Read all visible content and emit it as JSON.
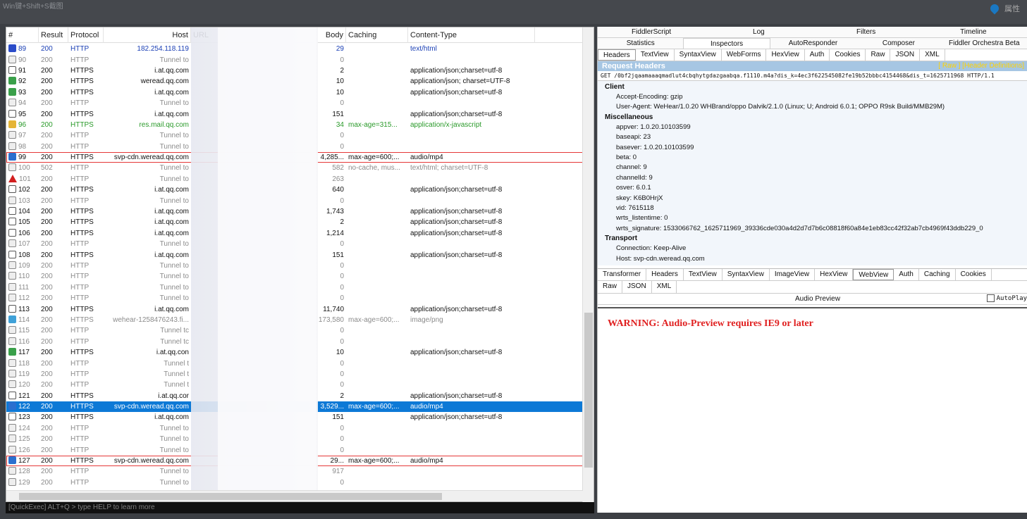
{
  "tip": "Win键+Shift+S截图",
  "top_right": {
    "label": "属性"
  },
  "columns": [
    "#",
    "Result",
    "Protocol",
    "Host",
    "URL",
    "Body",
    "Caching",
    "Content-Type"
  ],
  "sessions": [
    {
      "num": "89",
      "res": "200",
      "proto": "HTTP",
      "host": "182.254.118.119",
      "body": "29",
      "cache": "",
      "ctype": "text/html",
      "kind": "blue",
      "icon": "i-dbl"
    },
    {
      "num": "90",
      "res": "200",
      "proto": "HTTP",
      "host": "Tunnel to",
      "body": "0",
      "cache": "",
      "ctype": "",
      "kind": "tunnel",
      "icon": "i-lock"
    },
    {
      "num": "91",
      "res": "200",
      "proto": "HTTPS",
      "host": "i.at.qq.com",
      "body": "2",
      "cache": "",
      "ctype": "application/json;charset=utf-8",
      "kind": "https",
      "icon": "i-json"
    },
    {
      "num": "92",
      "res": "200",
      "proto": "HTTPS",
      "host": "weread.qq.com",
      "body": "10",
      "cache": "",
      "ctype": "application/json; charset=UTF-8",
      "kind": "https",
      "icon": "i-arrow"
    },
    {
      "num": "93",
      "res": "200",
      "proto": "HTTPS",
      "host": "i.at.qq.com",
      "body": "10",
      "cache": "",
      "ctype": "application/json;charset=utf-8",
      "kind": "https",
      "icon": "i-arrow"
    },
    {
      "num": "94",
      "res": "200",
      "proto": "HTTP",
      "host": "Tunnel to",
      "body": "0",
      "cache": "",
      "ctype": "",
      "kind": "tunnel",
      "icon": "i-lock"
    },
    {
      "num": "95",
      "res": "200",
      "proto": "HTTPS",
      "host": "i.at.qq.com",
      "body": "151",
      "cache": "",
      "ctype": "application/json;charset=utf-8",
      "kind": "https",
      "icon": "i-json"
    },
    {
      "num": "96",
      "res": "200",
      "proto": "HTTPS",
      "host": "res.mail.qq.com",
      "body": "34",
      "cache": "max-age=315...",
      "ctype": "application/x-javascript",
      "kind": "green",
      "icon": "i-js"
    },
    {
      "num": "97",
      "res": "200",
      "proto": "HTTP",
      "host": "Tunnel to",
      "body": "0",
      "cache": "",
      "ctype": "",
      "kind": "tunnel",
      "icon": "i-lock"
    },
    {
      "num": "98",
      "res": "200",
      "proto": "HTTP",
      "host": "Tunnel to",
      "body": "0",
      "cache": "",
      "ctype": "",
      "kind": "tunnel",
      "icon": "i-lock"
    },
    {
      "num": "99",
      "res": "200",
      "proto": "HTTPS",
      "host": "svp-cdn.weread.qq.com",
      "body": "4,285...",
      "cache": "max-age=600;...",
      "ctype": "audio/mp4",
      "kind": "https boxed",
      "icon": "i-audio"
    },
    {
      "num": "100",
      "res": "502",
      "proto": "HTTP",
      "host": "Tunnel to",
      "body": "582",
      "cache": "no-cache, mus...",
      "ctype": "text/html; charset=UTF-8",
      "kind": "tunnel",
      "icon": "i-lock"
    },
    {
      "num": "101",
      "res": "200",
      "proto": "HTTP",
      "host": "Tunnel to",
      "body": "263",
      "cache": "",
      "ctype": "",
      "kind": "tunnel",
      "icon": "i-warn"
    },
    {
      "num": "102",
      "res": "200",
      "proto": "HTTPS",
      "host": "i.at.qq.com",
      "body": "640",
      "cache": "",
      "ctype": "application/json;charset=utf-8",
      "kind": "https",
      "icon": "i-json"
    },
    {
      "num": "103",
      "res": "200",
      "proto": "HTTP",
      "host": "Tunnel to",
      "body": "0",
      "cache": "",
      "ctype": "",
      "kind": "tunnel",
      "icon": "i-lock"
    },
    {
      "num": "104",
      "res": "200",
      "proto": "HTTPS",
      "host": "i.at.qq.com",
      "body": "1,743",
      "cache": "",
      "ctype": "application/json;charset=utf-8",
      "kind": "https",
      "icon": "i-json"
    },
    {
      "num": "105",
      "res": "200",
      "proto": "HTTPS",
      "host": "i.at.qq.com",
      "body": "2",
      "cache": "",
      "ctype": "application/json;charset=utf-8",
      "kind": "https",
      "icon": "i-json"
    },
    {
      "num": "106",
      "res": "200",
      "proto": "HTTPS",
      "host": "i.at.qq.com",
      "body": "1,214",
      "cache": "",
      "ctype": "application/json;charset=utf-8",
      "kind": "https",
      "icon": "i-json"
    },
    {
      "num": "107",
      "res": "200",
      "proto": "HTTP",
      "host": "Tunnel to",
      "body": "0",
      "cache": "",
      "ctype": "",
      "kind": "tunnel",
      "icon": "i-lock"
    },
    {
      "num": "108",
      "res": "200",
      "proto": "HTTPS",
      "host": "i.at.qq.com",
      "body": "151",
      "cache": "",
      "ctype": "application/json;charset=utf-8",
      "kind": "https",
      "icon": "i-json"
    },
    {
      "num": "109",
      "res": "200",
      "proto": "HTTP",
      "host": "Tunnel to",
      "body": "0",
      "cache": "",
      "ctype": "",
      "kind": "tunnel",
      "icon": "i-lock"
    },
    {
      "num": "110",
      "res": "200",
      "proto": "HTTP",
      "host": "Tunnel to",
      "body": "0",
      "cache": "",
      "ctype": "",
      "kind": "tunnel",
      "icon": "i-lock"
    },
    {
      "num": "111",
      "res": "200",
      "proto": "HTTP",
      "host": "Tunnel to",
      "body": "0",
      "cache": "",
      "ctype": "",
      "kind": "tunnel",
      "icon": "i-lock"
    },
    {
      "num": "112",
      "res": "200",
      "proto": "HTTP",
      "host": "Tunnel to",
      "body": "0",
      "cache": "",
      "ctype": "",
      "kind": "tunnel",
      "icon": "i-lock"
    },
    {
      "num": "113",
      "res": "200",
      "proto": "HTTPS",
      "host": "i.at.qq.com",
      "body": "11,740",
      "cache": "",
      "ctype": "application/json;charset=utf-8",
      "kind": "https",
      "icon": "i-json"
    },
    {
      "num": "114",
      "res": "200",
      "proto": "HTTPS",
      "host": "wehear-1258476243.fi...",
      "body": "173,580",
      "cache": "max-age=600;...",
      "ctype": "image/png",
      "kind": "tunnel",
      "icon": "i-img"
    },
    {
      "num": "115",
      "res": "200",
      "proto": "HTTP",
      "host": "Tunnel tc",
      "body": "0",
      "cache": "",
      "ctype": "",
      "kind": "tunnel",
      "icon": "i-lock"
    },
    {
      "num": "116",
      "res": "200",
      "proto": "HTTP",
      "host": "Tunnel tc",
      "body": "0",
      "cache": "",
      "ctype": "",
      "kind": "tunnel",
      "icon": "i-lock"
    },
    {
      "num": "117",
      "res": "200",
      "proto": "HTTPS",
      "host": "i.at.qq.con",
      "body": "10",
      "cache": "",
      "ctype": "application/json;charset=utf-8",
      "kind": "https",
      "icon": "i-arrow"
    },
    {
      "num": "118",
      "res": "200",
      "proto": "HTTP",
      "host": "Tunnel t",
      "body": "0",
      "cache": "",
      "ctype": "",
      "kind": "tunnel",
      "icon": "i-lock"
    },
    {
      "num": "119",
      "res": "200",
      "proto": "HTTP",
      "host": "Tunnel t",
      "body": "0",
      "cache": "",
      "ctype": "",
      "kind": "tunnel",
      "icon": "i-lock"
    },
    {
      "num": "120",
      "res": "200",
      "proto": "HTTP",
      "host": "Tunnel t",
      "body": "0",
      "cache": "",
      "ctype": "",
      "kind": "tunnel",
      "icon": "i-lock"
    },
    {
      "num": "121",
      "res": "200",
      "proto": "HTTPS",
      "host": "i.at.qq.cor",
      "body": "2",
      "cache": "",
      "ctype": "application/json;charset=utf-8",
      "kind": "https",
      "icon": "i-json"
    },
    {
      "num": "122",
      "res": "200",
      "proto": "HTTPS",
      "host": "svp-cdn.weread.qq.com",
      "body": "3,529...",
      "cache": "max-age=600;...",
      "ctype": "audio/mp4",
      "kind": "sel",
      "icon": "i-audio"
    },
    {
      "num": "123",
      "res": "200",
      "proto": "HTTPS",
      "host": "i.at.qq.com",
      "body": "151",
      "cache": "",
      "ctype": "application/json;charset=utf-8",
      "kind": "https",
      "icon": "i-json"
    },
    {
      "num": "124",
      "res": "200",
      "proto": "HTTP",
      "host": "Tunnel to",
      "body": "0",
      "cache": "",
      "ctype": "",
      "kind": "tunnel",
      "icon": "i-lock"
    },
    {
      "num": "125",
      "res": "200",
      "proto": "HTTP",
      "host": "Tunnel to",
      "body": "0",
      "cache": "",
      "ctype": "",
      "kind": "tunnel",
      "icon": "i-lock"
    },
    {
      "num": "126",
      "res": "200",
      "proto": "HTTP",
      "host": "Tunnel to",
      "body": "0",
      "cache": "",
      "ctype": "",
      "kind": "tunnel",
      "icon": "i-lock"
    },
    {
      "num": "127",
      "res": "200",
      "proto": "HTTPS",
      "host": "svp-cdn.weread.qq.com",
      "body": "29...",
      "cache": "max-age=600;...",
      "ctype": "audio/mp4",
      "kind": "https boxed",
      "icon": "i-audio"
    },
    {
      "num": "128",
      "res": "200",
      "proto": "HTTP",
      "host": "Tunnel to",
      "body": "917",
      "cache": "",
      "ctype": "",
      "kind": "tunnel",
      "icon": "i-lock"
    },
    {
      "num": "129",
      "res": "200",
      "proto": "HTTP",
      "host": "Tunnel to",
      "body": "0",
      "cache": "",
      "ctype": "",
      "kind": "tunnel",
      "icon": "i-lock"
    }
  ],
  "quickexec": "[QuickExec] ALT+Q > type HELP to learn more",
  "tabs_row1": [
    "FiddlerScript",
    "Log",
    "Filters",
    "Timeline"
  ],
  "tabs_row2": [
    "Statistics",
    "Inspectors",
    "AutoResponder",
    "Composer",
    "Fiddler Orchestra Beta"
  ],
  "request_tabs": [
    "Headers",
    "TextView",
    "SyntaxView",
    "WebForms",
    "HexView",
    "Auth",
    "Cookies",
    "Raw",
    "JSON",
    "XML"
  ],
  "request_headers_title": "Request Headers",
  "request_headers_links": "[ Raw ]  [Header Definitions]",
  "request_line": "GET /0bf2jqaamaaaqmadlut4cbqhytgdazgaabqa.f1110.m4a?dis_k=4ec3f622545082fe19b52bbbc4154468&dis_t=1625711968 HTTP/1.1",
  "groups": [
    {
      "name": "Client",
      "items": [
        "Accept-Encoding: gzip",
        "User-Agent: WeHear/1.0.20 WHBrand/oppo Dalvik/2.1.0 (Linux; U; Android 6.0.1; OPPO R9sk Build/MMB29M)"
      ]
    },
    {
      "name": "Miscellaneous",
      "items": [
        "appver: 1.0.20.10103599",
        "baseapi: 23",
        "basever: 1.0.20.10103599",
        "beta: 0",
        "channel: 9",
        "channelId: 9",
        "osver: 6.0.1",
        "skey: K6B0HrjX",
        "vid: 7615118",
        "wrts_listentime: 0",
        "wrts_signature: 1533066762_1625711969_39336cde030a4d2d7d7b6c08818f60a84e1eb83cc42f32ab7cb4969f43ddb229_0"
      ]
    },
    {
      "name": "Transport",
      "items": [
        "Connection: Keep-Alive",
        "Host: svp-cdn.weread.qq.com"
      ]
    }
  ],
  "response_tabs1": [
    "Transformer",
    "Headers",
    "TextView",
    "SyntaxView",
    "ImageView",
    "HexView",
    "WebView",
    "Auth",
    "Caching",
    "Cookies"
  ],
  "response_tabs2": [
    "Raw",
    "JSON",
    "XML"
  ],
  "audio_preview": "Audio Preview",
  "autoplay": "AutoPlay",
  "warning": "WARNING: Audio-Preview requires IE9 or later"
}
